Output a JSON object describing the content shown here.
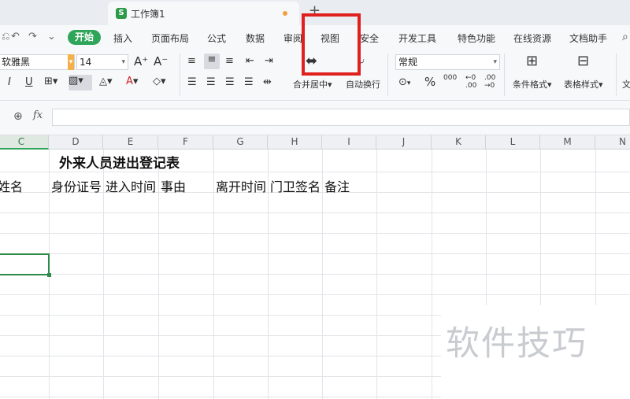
{
  "window": {
    "doc_tab_logo": "S",
    "doc_tab_name": "工作簿1",
    "new_tab": "+"
  },
  "menu": {
    "quick_icons": [
      "⎌",
      "↶",
      "↷",
      "⌄"
    ],
    "items": [
      "开始",
      "插入",
      "页面布局",
      "公式",
      "数据",
      "审阅",
      "视图",
      "安全",
      "开发工具",
      "特色功能",
      "在线资源",
      "文档助手"
    ]
  },
  "ribbon": {
    "font_name": "软雅黑",
    "font_size": "14",
    "increase_font": "A⁺",
    "decrease_font": "A⁻",
    "bold": "I",
    "underline": "U",
    "merge_label": "合并居中",
    "wrap_label": "自动换行",
    "number_format": "常规",
    "currency": "¥",
    "percent": "%",
    "thousands": "000",
    "inc_decimal": "←0 .00",
    "dec_decimal": ".00 →0",
    "cond_format_label": "条件格式",
    "table_style_label": "表格样式",
    "doc_label": "文"
  },
  "formula_bar": {
    "fx": "fx",
    "value": ""
  },
  "grid": {
    "columns": [
      "C",
      "D",
      "E",
      "F",
      "G",
      "H",
      "I",
      "J",
      "K",
      "L",
      "M",
      "N"
    ],
    "active_column": "C",
    "title": "外来人员进出登记表",
    "headers": [
      "姓名",
      "身份证号",
      "进入时间",
      "事由",
      "离开时间",
      "门卫签名",
      "备注"
    ]
  },
  "watermark": "软件技巧",
  "colors": {
    "accent": "#2fa55a",
    "highlight": "#e0201e"
  }
}
